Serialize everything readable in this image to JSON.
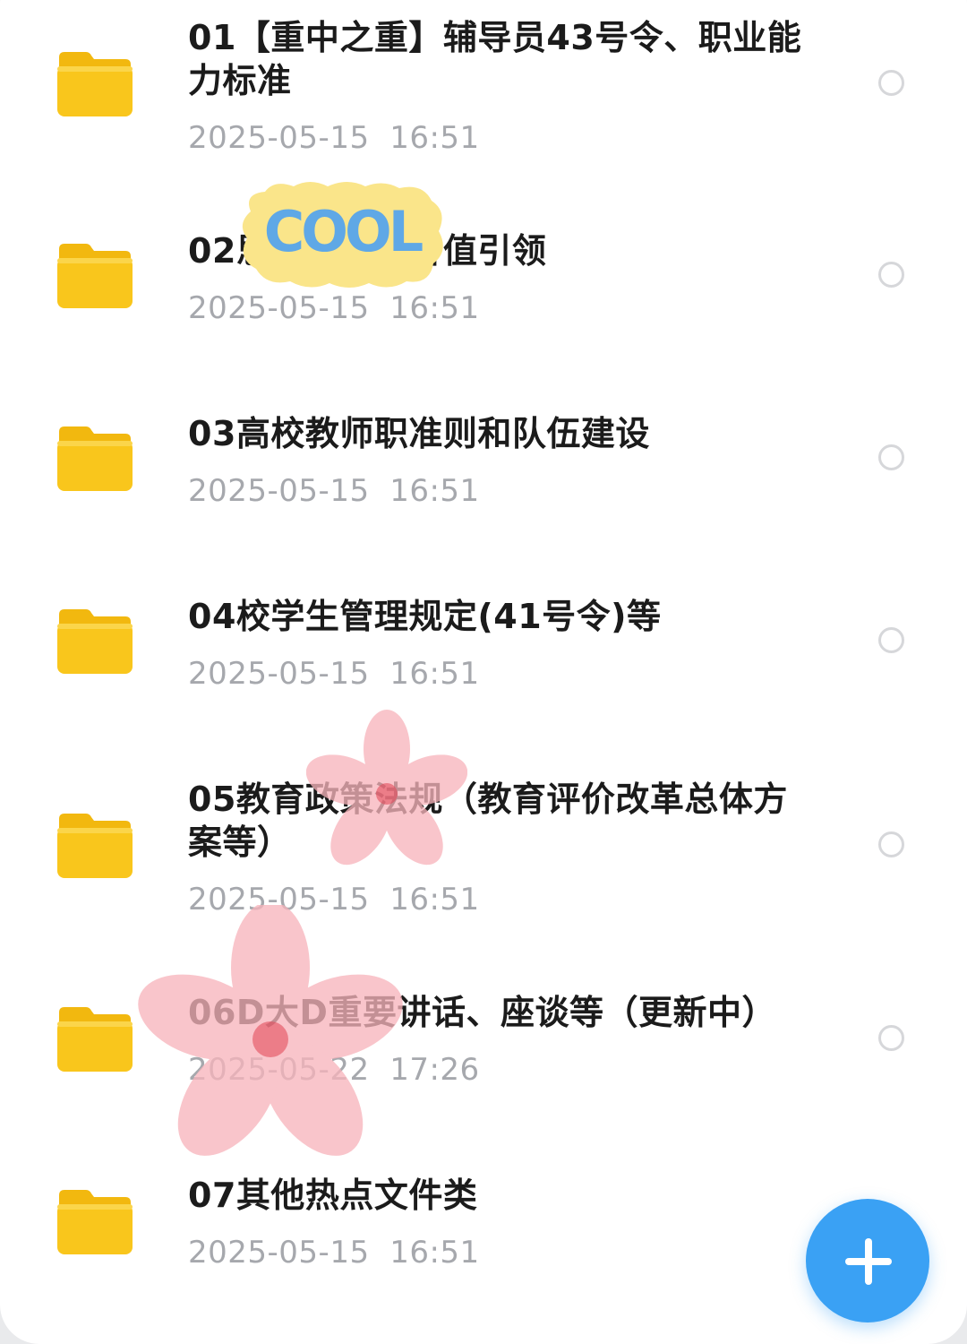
{
  "folders": [
    {
      "name": "01【重中之重】辅导员43号令、职业能力标准",
      "date": "2025-05-15  16:51"
    },
    {
      "name": "02思想教育与价值引领",
      "date": "2025-05-15  16:51"
    },
    {
      "name": "03高校教师职准则和队伍建设",
      "date": "2025-05-15  16:51"
    },
    {
      "name": "04校学生管理规定(41号令)等",
      "date": "2025-05-15  16:51"
    },
    {
      "name": "05教育政策法规（教育评价改革总体方案等）",
      "date": "2025-05-15  16:51"
    },
    {
      "name": "06D大D重要讲话、座谈等（更新中）",
      "date": "2025-05-22  17:26"
    },
    {
      "name": "07其他热点文件类",
      "date": "2025-05-15  16:51"
    }
  ],
  "sticker_text": "COOL",
  "fab": {
    "icon": "plus-icon"
  },
  "colors": {
    "folder": "#f9c61c",
    "fab": "#3aa1f4",
    "date": "#a6a8ad",
    "title": "#1b1b1b"
  }
}
